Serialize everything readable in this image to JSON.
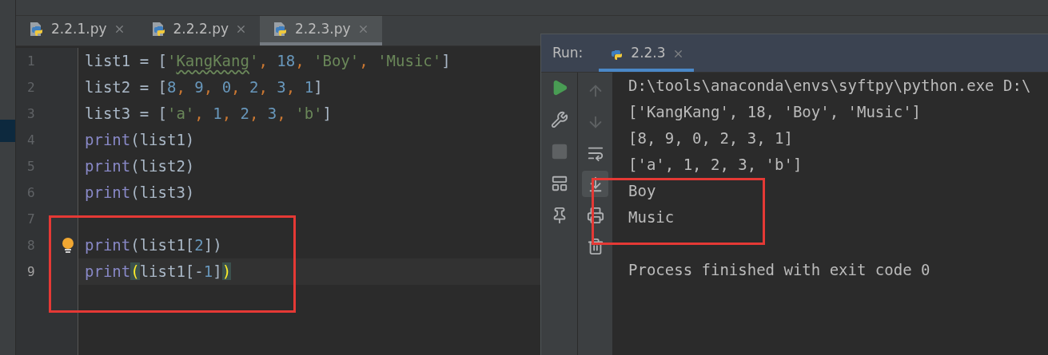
{
  "editor_tabs": [
    {
      "label": "2.2.1.py",
      "selected": false
    },
    {
      "label": "2.2.2.py",
      "selected": false
    },
    {
      "label": "2.2.3.py",
      "selected": true
    }
  ],
  "code_lines": [
    {
      "number": "1",
      "current": false,
      "tokens": [
        {
          "kind": "plain",
          "text": "list1 = ["
        },
        {
          "kind": "string",
          "text": "'"
        },
        {
          "kind": "string",
          "text": "KangKang",
          "underline": true
        },
        {
          "kind": "string",
          "text": "'"
        },
        {
          "kind": "comma",
          "text": ", "
        },
        {
          "kind": "number",
          "text": "18"
        },
        {
          "kind": "comma",
          "text": ", "
        },
        {
          "kind": "string",
          "text": "'Boy'"
        },
        {
          "kind": "comma",
          "text": ", "
        },
        {
          "kind": "string",
          "text": "'Music'"
        },
        {
          "kind": "plain",
          "text": "]"
        }
      ]
    },
    {
      "number": "2",
      "current": false,
      "tokens": [
        {
          "kind": "plain",
          "text": "list2 = ["
        },
        {
          "kind": "number",
          "text": "8"
        },
        {
          "kind": "comma",
          "text": ", "
        },
        {
          "kind": "number",
          "text": "9"
        },
        {
          "kind": "comma",
          "text": ", "
        },
        {
          "kind": "number",
          "text": "0"
        },
        {
          "kind": "comma",
          "text": ", "
        },
        {
          "kind": "number",
          "text": "2"
        },
        {
          "kind": "comma",
          "text": ", "
        },
        {
          "kind": "number",
          "text": "3"
        },
        {
          "kind": "comma",
          "text": ", "
        },
        {
          "kind": "number",
          "text": "1"
        },
        {
          "kind": "plain",
          "text": "]"
        }
      ]
    },
    {
      "number": "3",
      "current": false,
      "tokens": [
        {
          "kind": "plain",
          "text": "list3 = ["
        },
        {
          "kind": "string",
          "text": "'a'"
        },
        {
          "kind": "comma",
          "text": ", "
        },
        {
          "kind": "number",
          "text": "1"
        },
        {
          "kind": "comma",
          "text": ", "
        },
        {
          "kind": "number",
          "text": "2"
        },
        {
          "kind": "comma",
          "text": ", "
        },
        {
          "kind": "number",
          "text": "3"
        },
        {
          "kind": "comma",
          "text": ", "
        },
        {
          "kind": "string",
          "text": "'b'"
        },
        {
          "kind": "plain",
          "text": "]"
        }
      ]
    },
    {
      "number": "4",
      "current": false,
      "tokens": [
        {
          "kind": "builtin",
          "text": "print"
        },
        {
          "kind": "plain",
          "text": "(list1)"
        }
      ]
    },
    {
      "number": "5",
      "current": false,
      "tokens": [
        {
          "kind": "builtin",
          "text": "print"
        },
        {
          "kind": "plain",
          "text": "(list2)"
        }
      ]
    },
    {
      "number": "6",
      "current": false,
      "tokens": [
        {
          "kind": "builtin",
          "text": "print"
        },
        {
          "kind": "plain",
          "text": "(list3)"
        }
      ]
    },
    {
      "number": "7",
      "current": false
    },
    {
      "number": "8",
      "current": false,
      "bulb": true,
      "tokens": [
        {
          "kind": "builtin",
          "text": "print"
        },
        {
          "kind": "plain",
          "text": "(list1["
        },
        {
          "kind": "number",
          "text": "2"
        },
        {
          "kind": "plain",
          "text": "])"
        }
      ]
    },
    {
      "number": "9",
      "current": true,
      "tokens": [
        {
          "kind": "builtin",
          "text": "print"
        },
        {
          "kind": "bracket_match",
          "text": "("
        },
        {
          "kind": "plain",
          "text": "list1[-"
        },
        {
          "kind": "number",
          "text": "1"
        },
        {
          "kind": "plain",
          "text": "]"
        },
        {
          "kind": "bracket_match",
          "text": ")"
        }
      ]
    }
  ],
  "run_panel": {
    "title": "Run:",
    "tabs": [
      {
        "label": "2.2.3",
        "selected": true
      }
    ],
    "side_tools": [
      {
        "kind": "run"
      },
      {
        "kind": "settings"
      },
      {
        "kind": "stop"
      },
      {
        "kind": "layout"
      },
      {
        "kind": "pin"
      }
    ],
    "output_tools": [
      {
        "kind": "up",
        "disabled": true,
        "on": false
      },
      {
        "kind": "down",
        "disabled": true,
        "on": false
      },
      {
        "kind": "wrap",
        "disabled": false,
        "on": false
      },
      {
        "kind": "scroll_end",
        "disabled": false,
        "on": true
      },
      {
        "kind": "print",
        "disabled": false,
        "on": false
      },
      {
        "kind": "trash",
        "disabled": false,
        "on": false
      }
    ],
    "output_lines": [
      "D:\\tools\\anaconda\\envs\\syftpy\\python.exe D:\\",
      "['KangKang', 18, 'Boy', 'Music']",
      "[8, 9, 0, 2, 3, 1]",
      "['a', 1, 2, 3, 'b']",
      "Boy",
      "Music"
    ],
    "exit_message": "Process finished with exit code 0"
  }
}
